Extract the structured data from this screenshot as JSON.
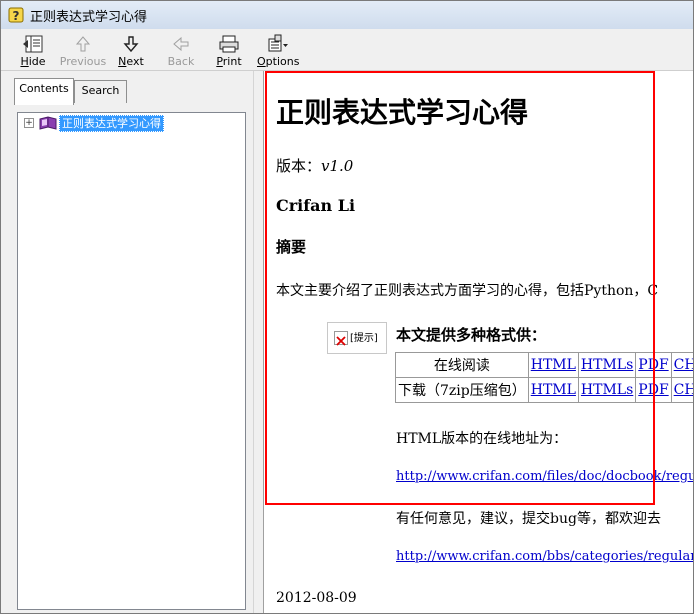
{
  "window": {
    "title": "正则表达式学习心得"
  },
  "toolbar": {
    "hide": "Hide",
    "previous": "Previous",
    "next": "Next",
    "back": "Back",
    "print": "Print",
    "options": "Options"
  },
  "tabs": [
    {
      "label": "Contents"
    },
    {
      "label": "Search"
    }
  ],
  "tree": {
    "items": [
      {
        "label": "正则表达式学习心得",
        "selected": true
      }
    ]
  },
  "doc": {
    "title": "正则表达式学习心得",
    "version_label": "版本：",
    "version_value": "v1.0",
    "author": "Crifan Li",
    "abstract_heading": "摘要",
    "abstract_text": "本文主要介绍了正则表达式方面学习的心得，包括Python，C",
    "tip_label": "[提示]",
    "tip_heading": "本文提供多种格式供：",
    "formats": [
      {
        "label": "在线阅读",
        "links": [
          "HTML",
          "HTMLs",
          "PDF",
          "CHM"
        ]
      },
      {
        "label": "下载（7zip压缩包）",
        "links": [
          "HTML",
          "HTMLs",
          "PDF",
          "CHM"
        ]
      }
    ],
    "online_intro": "HTML版本的在线地址为：",
    "online_url": "http://www.crifan.com/files/doc/docbook/regular_",
    "feedback_text": "有任何意见，建议，提交bug等，都欢迎去",
    "feedback_url": "http://www.crifan.com/bbs/categories/regular_exp",
    "date": "2012-08-09"
  },
  "highlight_color": "#ff0000",
  "selection_color": "#3399ff",
  "link_color": "#0000cc"
}
